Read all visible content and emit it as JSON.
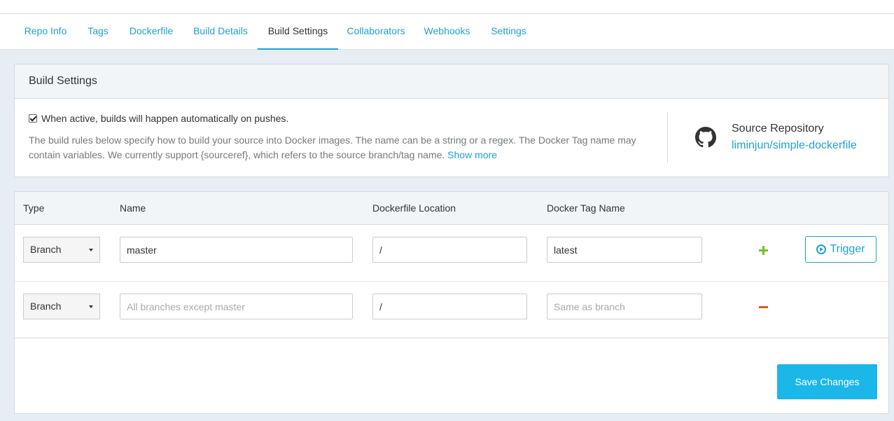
{
  "tabs": [
    {
      "label": "Repo Info"
    },
    {
      "label": "Tags"
    },
    {
      "label": "Dockerfile"
    },
    {
      "label": "Build Details"
    },
    {
      "label": "Build Settings",
      "active": true
    },
    {
      "label": "Collaborators"
    },
    {
      "label": "Webhooks"
    },
    {
      "label": "Settings"
    }
  ],
  "build_settings": {
    "title": "Build Settings",
    "autobuild_label": "When active, builds will happen automatically on pushes.",
    "autobuild_checked": true,
    "description": "The build rules below specify how to build your source into Docker images. The name can be a string or a regex. The Docker Tag name may contain variables. We currently support {sourceref}, which refers to the source branch/tag name.",
    "show_more": "Show more",
    "source_label": "Source Repository",
    "source_link": "liminjun/simple-dockerfile"
  },
  "rules": {
    "headers": {
      "type": "Type",
      "name": "Name",
      "location": "Dockerfile Location",
      "tag": "Docker Tag Name"
    },
    "rows": [
      {
        "type": "Branch",
        "name_value": "master",
        "name_placeholder": "",
        "location_value": "/",
        "tag_value": "latest",
        "tag_placeholder": "",
        "action": "add",
        "trigger_label": "Trigger"
      },
      {
        "type": "Branch",
        "name_value": "",
        "name_placeholder": "All branches except master",
        "location_value": "/",
        "tag_value": "",
        "tag_placeholder": "Same as branch",
        "action": "remove"
      }
    ],
    "save_label": "Save Changes"
  },
  "colors": {
    "accent": "#1ea1d4",
    "add": "#7dbf2a",
    "remove": "#e0581b",
    "save_bg": "#1bb7e8"
  }
}
